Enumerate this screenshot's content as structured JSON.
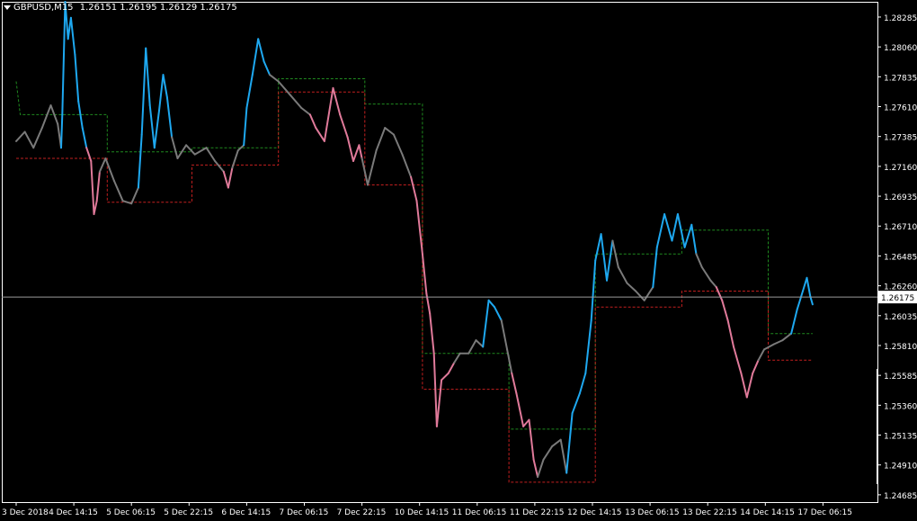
{
  "header": {
    "symbol": "GBPUSD,M15",
    "open": "1.26151",
    "high": "1.26195",
    "low": "1.26129",
    "close": "1.26175"
  },
  "price_axis": {
    "labels": [
      "1.28285",
      "1.28060",
      "1.27835",
      "1.27610",
      "1.27385",
      "1.27160",
      "1.26935",
      "1.26710",
      "1.26485",
      "1.26260",
      "1.26035",
      "1.25810",
      "1.25585",
      "1.25360",
      "1.25135",
      "1.24910",
      "1.24685"
    ],
    "current_price_label": "1.26175"
  },
  "time_axis": {
    "labels": [
      "3 Dec 2018",
      "4 Dec 14:15",
      "5 Dec 06:15",
      "5 Dec 22:15",
      "6 Dec 14:15",
      "7 Dec 06:15",
      "7 Dec 22:15",
      "10 Dec 14:15",
      "11 Dec 06:15",
      "11 Dec 22:15",
      "12 Dec 14:15",
      "13 Dec 06:15",
      "13 Dec 22:15",
      "14 Dec 14:15",
      "17 Dec 06:15"
    ]
  },
  "colors": {
    "background": "#000000",
    "axis": "#ffffff",
    "up": "#1ea8f0",
    "down": "#e07a9a",
    "neutral": "#7a7a7a",
    "upper_band": "#1f8a1f",
    "lower_band": "#c21f1f",
    "current_line": "#9a9a9a"
  },
  "chart_data": {
    "type": "line",
    "title": "GBPUSD,M15",
    "ylim": [
      1.2463,
      1.284
    ],
    "x_categories": [
      "3 Dec 2018",
      "4 Dec 14:15",
      "5 Dec 06:15",
      "5 Dec 22:15",
      "6 Dec 14:15",
      "7 Dec 06:15",
      "7 Dec 22:15",
      "10 Dec 14:15",
      "11 Dec 06:15",
      "11 Dec 22:15",
      "12 Dec 14:15",
      "13 Dec 06:15",
      "13 Dec 22:15",
      "14 Dec 14:15",
      "17 Dec 06:15"
    ],
    "price_series": [
      [
        0,
        1.2735,
        "n"
      ],
      [
        0.15,
        1.2742,
        "n"
      ],
      [
        0.3,
        1.273,
        "n"
      ],
      [
        0.45,
        1.2745,
        "n"
      ],
      [
        0.6,
        1.2762,
        "n"
      ],
      [
        0.72,
        1.2748,
        "n"
      ],
      [
        0.78,
        1.273,
        "n"
      ],
      [
        0.8,
        1.2755,
        "u"
      ],
      [
        0.85,
        1.284,
        "u"
      ],
      [
        0.9,
        1.2812,
        "u"
      ],
      [
        0.95,
        1.2828,
        "u"
      ],
      [
        1.02,
        1.28,
        "u"
      ],
      [
        1.08,
        1.2765,
        "u"
      ],
      [
        1.15,
        1.2745,
        "u"
      ],
      [
        1.22,
        1.273,
        "u"
      ],
      [
        1.3,
        1.272,
        "d"
      ],
      [
        1.35,
        1.268,
        "d"
      ],
      [
        1.4,
        1.269,
        "d"
      ],
      [
        1.45,
        1.2712,
        "d"
      ],
      [
        1.55,
        1.2722,
        "n"
      ],
      [
        1.7,
        1.2705,
        "n"
      ],
      [
        1.85,
        1.269,
        "n"
      ],
      [
        2.0,
        1.2688,
        "n"
      ],
      [
        2.12,
        1.27,
        "n"
      ],
      [
        2.18,
        1.274,
        "u"
      ],
      [
        2.25,
        1.2805,
        "u"
      ],
      [
        2.32,
        1.2762,
        "u"
      ],
      [
        2.4,
        1.273,
        "u"
      ],
      [
        2.48,
        1.2758,
        "u"
      ],
      [
        2.55,
        1.2785,
        "u"
      ],
      [
        2.62,
        1.2768,
        "u"
      ],
      [
        2.7,
        1.2738,
        "u"
      ],
      [
        2.8,
        1.2722,
        "n"
      ],
      [
        2.95,
        1.2732,
        "n"
      ],
      [
        3.1,
        1.2725,
        "n"
      ],
      [
        3.3,
        1.273,
        "n"
      ],
      [
        3.45,
        1.272,
        "n"
      ],
      [
        3.6,
        1.2712,
        "n"
      ],
      [
        3.68,
        1.27,
        "d"
      ],
      [
        3.75,
        1.2715,
        "d"
      ],
      [
        3.85,
        1.2728,
        "n"
      ],
      [
        3.95,
        1.2732,
        "n"
      ],
      [
        4.0,
        1.276,
        "u"
      ],
      [
        4.1,
        1.2785,
        "u"
      ],
      [
        4.2,
        1.2812,
        "u"
      ],
      [
        4.3,
        1.2795,
        "u"
      ],
      [
        4.4,
        1.2785,
        "u"
      ],
      [
        4.55,
        1.278,
        "n"
      ],
      [
        4.75,
        1.277,
        "n"
      ],
      [
        4.95,
        1.276,
        "n"
      ],
      [
        5.1,
        1.2755,
        "n"
      ],
      [
        5.2,
        1.2745,
        "d"
      ],
      [
        5.35,
        1.2735,
        "d"
      ],
      [
        5.5,
        1.2775,
        "d"
      ],
      [
        5.62,
        1.2755,
        "d"
      ],
      [
        5.75,
        1.2738,
        "d"
      ],
      [
        5.85,
        1.272,
        "d"
      ],
      [
        5.95,
        1.2732,
        "d"
      ],
      [
        6.0,
        1.2722,
        "d"
      ],
      [
        6.1,
        1.2702,
        "n"
      ],
      [
        6.25,
        1.2728,
        "n"
      ],
      [
        6.4,
        1.2745,
        "n"
      ],
      [
        6.55,
        1.274,
        "n"
      ],
      [
        6.7,
        1.2725,
        "n"
      ],
      [
        6.85,
        1.2708,
        "n"
      ],
      [
        6.95,
        1.269,
        "d"
      ],
      [
        7.05,
        1.265,
        "d"
      ],
      [
        7.12,
        1.262,
        "d"
      ],
      [
        7.18,
        1.2605,
        "d"
      ],
      [
        7.25,
        1.2575,
        "d"
      ],
      [
        7.3,
        1.252,
        "d"
      ],
      [
        7.38,
        1.2555,
        "d"
      ],
      [
        7.5,
        1.256,
        "d"
      ],
      [
        7.6,
        1.2568,
        "d"
      ],
      [
        7.7,
        1.2575,
        "n"
      ],
      [
        7.85,
        1.2575,
        "n"
      ],
      [
        7.98,
        1.2585,
        "n"
      ],
      [
        8.1,
        1.258,
        "n"
      ],
      [
        8.2,
        1.2615,
        "u"
      ],
      [
        8.3,
        1.261,
        "u"
      ],
      [
        8.42,
        1.26,
        "u"
      ],
      [
        8.52,
        1.2578,
        "n"
      ],
      [
        8.6,
        1.256,
        "n"
      ],
      [
        8.68,
        1.2545,
        "d"
      ],
      [
        8.8,
        1.252,
        "d"
      ],
      [
        8.9,
        1.2525,
        "d"
      ],
      [
        8.98,
        1.2495,
        "d"
      ],
      [
        9.05,
        1.2482,
        "d"
      ],
      [
        9.15,
        1.2495,
        "n"
      ],
      [
        9.3,
        1.2505,
        "n"
      ],
      [
        9.45,
        1.251,
        "n"
      ],
      [
        9.55,
        1.2485,
        "n"
      ],
      [
        9.65,
        1.253,
        "u"
      ],
      [
        9.78,
        1.2545,
        "u"
      ],
      [
        9.88,
        1.256,
        "u"
      ],
      [
        9.98,
        1.26,
        "u"
      ],
      [
        10.05,
        1.2645,
        "u"
      ],
      [
        10.15,
        1.2665,
        "u"
      ],
      [
        10.25,
        1.263,
        "u"
      ],
      [
        10.35,
        1.266,
        "u"
      ],
      [
        10.45,
        1.264,
        "n"
      ],
      [
        10.6,
        1.2628,
        "n"
      ],
      [
        10.75,
        1.2622,
        "n"
      ],
      [
        10.9,
        1.2615,
        "n"
      ],
      [
        11.05,
        1.2625,
        "n"
      ],
      [
        11.12,
        1.2655,
        "u"
      ],
      [
        11.25,
        1.268,
        "u"
      ],
      [
        11.38,
        1.266,
        "u"
      ],
      [
        11.48,
        1.268,
        "u"
      ],
      [
        11.6,
        1.2655,
        "u"
      ],
      [
        11.72,
        1.2672,
        "u"
      ],
      [
        11.8,
        1.265,
        "u"
      ],
      [
        11.9,
        1.264,
        "n"
      ],
      [
        12.05,
        1.263,
        "n"
      ],
      [
        12.15,
        1.2625,
        "n"
      ],
      [
        12.25,
        1.2615,
        "d"
      ],
      [
        12.35,
        1.26,
        "d"
      ],
      [
        12.45,
        1.258,
        "d"
      ],
      [
        12.58,
        1.256,
        "d"
      ],
      [
        12.68,
        1.2542,
        "d"
      ],
      [
        12.78,
        1.256,
        "d"
      ],
      [
        12.88,
        1.257,
        "d"
      ],
      [
        12.98,
        1.2578,
        "n"
      ],
      [
        13.15,
        1.2582,
        "n"
      ],
      [
        13.3,
        1.2585,
        "n"
      ],
      [
        13.45,
        1.259,
        "n"
      ],
      [
        13.55,
        1.2608,
        "u"
      ],
      [
        13.65,
        1.2622,
        "u"
      ],
      [
        13.72,
        1.2632,
        "u"
      ],
      [
        13.78,
        1.2618,
        "u"
      ],
      [
        13.82,
        1.2612,
        "u"
      ]
    ],
    "upper_band": [
      [
        0,
        1.278
      ],
      [
        0.07,
        1.2755
      ],
      [
        1.58,
        1.2755
      ],
      [
        1.58,
        1.2727
      ],
      [
        3.05,
        1.2727
      ],
      [
        3.05,
        1.273
      ],
      [
        4.55,
        1.273
      ],
      [
        4.55,
        1.2782
      ],
      [
        6.05,
        1.2782
      ],
      [
        6.05,
        1.2763
      ],
      [
        7.05,
        1.2763
      ],
      [
        7.05,
        1.2575
      ],
      [
        8.55,
        1.2575
      ],
      [
        8.55,
        1.2518
      ],
      [
        10.05,
        1.2518
      ],
      [
        10.05,
        1.265
      ],
      [
        11.55,
        1.265
      ],
      [
        11.55,
        1.2668
      ],
      [
        13.05,
        1.2668
      ],
      [
        13.05,
        1.259
      ],
      [
        13.82,
        1.259
      ]
    ],
    "lower_band": [
      [
        0,
        1.2722
      ],
      [
        1.58,
        1.2722
      ],
      [
        1.58,
        1.2689
      ],
      [
        3.05,
        1.2689
      ],
      [
        3.05,
        1.2717
      ],
      [
        4.55,
        1.2717
      ],
      [
        4.55,
        1.2772
      ],
      [
        6.05,
        1.2772
      ],
      [
        6.05,
        1.2702
      ],
      [
        7.05,
        1.2702
      ],
      [
        7.05,
        1.2548
      ],
      [
        8.55,
        1.2548
      ],
      [
        8.55,
        1.2478
      ],
      [
        10.05,
        1.2478
      ],
      [
        10.05,
        1.261
      ],
      [
        11.55,
        1.261
      ],
      [
        11.55,
        1.2622
      ],
      [
        13.05,
        1.2622
      ],
      [
        13.05,
        1.257
      ],
      [
        13.82,
        1.257
      ]
    ],
    "current_price": 1.26175
  }
}
